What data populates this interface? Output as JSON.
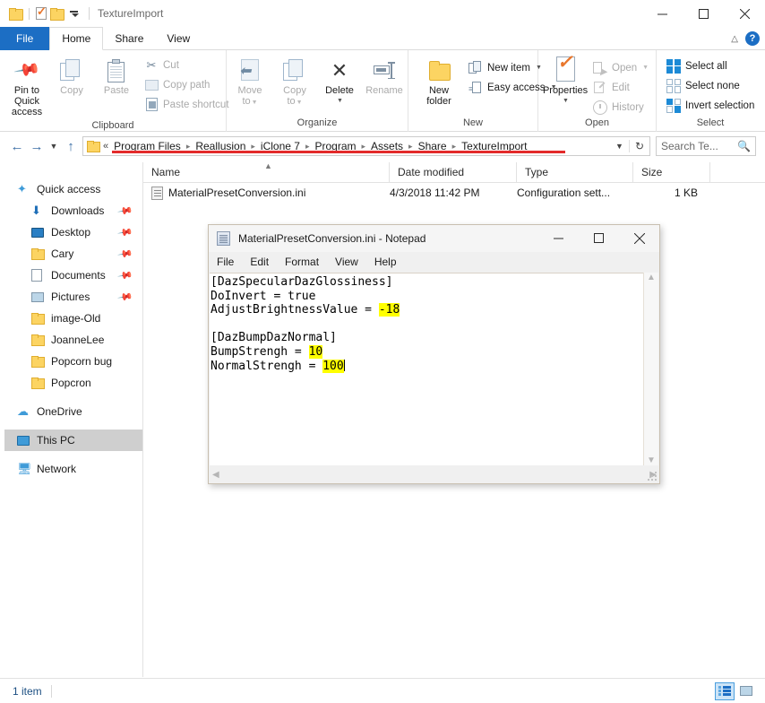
{
  "explorer": {
    "title": "TextureImport",
    "quick_access_toolbar": [
      {
        "name": "folder-properties-icon",
        "label": "Properties"
      },
      {
        "name": "new-folder-icon",
        "label": "New folder"
      },
      {
        "name": "customize-dropdown-icon",
        "label": "Customize Quick Access Toolbar"
      }
    ],
    "window_controls": {
      "minimize": "Minimize",
      "maximize": "Maximize",
      "close": "Close"
    },
    "tabs": [
      {
        "label": "File",
        "active": false
      },
      {
        "label": "Home",
        "active": true
      },
      {
        "label": "Share",
        "active": false
      },
      {
        "label": "View",
        "active": false
      }
    ],
    "ribbon_right": {
      "collapse": "Collapse the Ribbon",
      "help": "?"
    },
    "ribbon_groups": [
      {
        "label": "Clipboard",
        "big_buttons": [
          {
            "label": "Pin to Quick\naccess",
            "line1": "Pin to Quick",
            "line2": "access",
            "icon": "pin-icon",
            "disabled": false
          },
          {
            "label": "Copy",
            "line1": "Copy",
            "line2": "",
            "icon": "copy-icon",
            "disabled": true
          },
          {
            "label": "Paste",
            "line1": "Paste",
            "line2": "",
            "icon": "paste-icon",
            "disabled": true
          }
        ],
        "small_buttons": [
          {
            "label": "Cut",
            "icon": "scissors-icon",
            "disabled": true
          },
          {
            "label": "Copy path",
            "icon": "copy-path-icon",
            "disabled": true
          },
          {
            "label": "Paste shortcut",
            "icon": "paste-shortcut-icon",
            "disabled": true
          }
        ]
      },
      {
        "label": "Organize",
        "big_buttons": [
          {
            "label": "Move to",
            "line1": "Move",
            "line2": "to",
            "icon": "move-to-icon",
            "disabled": true,
            "caret": true
          },
          {
            "label": "Copy to",
            "line1": "Copy",
            "line2": "to",
            "icon": "copy-to-icon",
            "disabled": true,
            "caret": true
          },
          {
            "label": "Delete",
            "line1": "Delete",
            "line2": "",
            "icon": "delete-icon",
            "disabled": false,
            "caret": true
          },
          {
            "label": "Rename",
            "line1": "Rename",
            "line2": "",
            "icon": "rename-icon",
            "disabled": true
          }
        ],
        "small_buttons": []
      },
      {
        "label": "New",
        "big_buttons": [
          {
            "label": "New folder",
            "line1": "New",
            "line2": "folder",
            "icon": "new-folder-icon",
            "disabled": false
          }
        ],
        "small_buttons": [
          {
            "label": "New item",
            "icon": "new-item-icon",
            "disabled": false,
            "caret": true
          },
          {
            "label": "Easy access",
            "icon": "easy-access-icon",
            "disabled": false,
            "caret": true
          }
        ]
      },
      {
        "label": "Open",
        "big_buttons": [
          {
            "label": "Properties",
            "line1": "Properties",
            "line2": "",
            "icon": "properties-icon",
            "disabled": false,
            "caret": true
          }
        ],
        "small_buttons": [
          {
            "label": "Open",
            "icon": "open-icon",
            "disabled": true,
            "caret": true
          },
          {
            "label": "Edit",
            "icon": "edit-icon",
            "disabled": true
          },
          {
            "label": "History",
            "icon": "history-icon",
            "disabled": true
          }
        ]
      },
      {
        "label": "Select",
        "big_buttons": [],
        "small_buttons": [
          {
            "label": "Select all",
            "icon": "select-all-icon",
            "disabled": false
          },
          {
            "label": "Select none",
            "icon": "select-none-icon",
            "disabled": false
          },
          {
            "label": "Invert selection",
            "icon": "invert-selection-icon",
            "disabled": false
          }
        ]
      }
    ],
    "nav": {
      "back": "Back",
      "forward": "Forward",
      "recent": "Recent locations",
      "up": "Up"
    },
    "address": {
      "overflow": "«",
      "crumbs": [
        "Program Files",
        "Reallusion",
        "iClone 7",
        "Program",
        "Assets",
        "Share",
        "TextureImport"
      ],
      "annotation_color": "#e32b2b"
    },
    "search": {
      "placeholder": "Search Te...",
      "icon": "search-icon"
    },
    "columns": [
      {
        "label": "Name",
        "sorted": true
      },
      {
        "label": "Date modified",
        "sorted": false
      },
      {
        "label": "Type",
        "sorted": false
      },
      {
        "label": "Size",
        "sorted": false
      }
    ],
    "sidebar": [
      {
        "label": "Quick access",
        "icon": "star-icon",
        "indent": false,
        "pinned": false,
        "selected": false
      },
      {
        "label": "Downloads",
        "icon": "downloads-icon",
        "indent": true,
        "pinned": true,
        "selected": false
      },
      {
        "label": "Desktop",
        "icon": "desktop-icon",
        "indent": true,
        "pinned": true,
        "selected": false
      },
      {
        "label": "Cary",
        "icon": "folder-icon",
        "indent": true,
        "pinned": true,
        "selected": false
      },
      {
        "label": "Documents",
        "icon": "documents-icon",
        "indent": true,
        "pinned": true,
        "selected": false
      },
      {
        "label": "Pictures",
        "icon": "pictures-icon",
        "indent": true,
        "pinned": true,
        "selected": false
      },
      {
        "label": "image-Old",
        "icon": "folder-icon",
        "indent": true,
        "pinned": false,
        "selected": false
      },
      {
        "label": "JoanneLee",
        "icon": "folder-icon",
        "indent": true,
        "pinned": false,
        "selected": false
      },
      {
        "label": "Popcorn bug",
        "icon": "folder-icon",
        "indent": true,
        "pinned": false,
        "selected": false
      },
      {
        "label": "Popcron",
        "icon": "folder-icon",
        "indent": true,
        "pinned": false,
        "selected": false
      },
      {
        "label": "OneDrive",
        "icon": "cloud-icon",
        "indent": false,
        "pinned": false,
        "selected": false
      },
      {
        "label": "This PC",
        "icon": "pc-icon",
        "indent": false,
        "pinned": false,
        "selected": true
      },
      {
        "label": "Network",
        "icon": "network-icon",
        "indent": false,
        "pinned": false,
        "selected": false
      }
    ],
    "files": [
      {
        "name": "MaterialPresetConversion.ini",
        "date_modified": "4/3/2018 11:42 PM",
        "type": "Configuration sett...",
        "size": "1 KB",
        "icon": "ini-file-icon"
      }
    ],
    "status": {
      "text": "1 item",
      "views": [
        {
          "name": "details-view-button",
          "label": "Details view",
          "active": true
        },
        {
          "name": "thumbnail-view-button",
          "label": "Large icons view",
          "active": false
        }
      ]
    }
  },
  "notepad": {
    "title": "MaterialPresetConversion.ini - Notepad",
    "icon": "notepad-icon",
    "menu": [
      "File",
      "Edit",
      "Format",
      "View",
      "Help"
    ],
    "window_controls": {
      "minimize": "Minimize",
      "maximize": "Maximize",
      "close": "Close"
    },
    "highlight_color": "#ffff00",
    "content_lines": [
      {
        "segments": [
          {
            "t": "[DazSpecularDazGlossiness]",
            "hl": false
          }
        ]
      },
      {
        "segments": [
          {
            "t": "DoInvert = true",
            "hl": false
          }
        ]
      },
      {
        "segments": [
          {
            "t": "AdjustBrightnessValue = ",
            "hl": false
          },
          {
            "t": "-18",
            "hl": true
          }
        ]
      },
      {
        "segments": [
          {
            "t": "",
            "hl": false
          }
        ]
      },
      {
        "segments": [
          {
            "t": "[DazBumpDazNormal]",
            "hl": false
          }
        ]
      },
      {
        "segments": [
          {
            "t": "BumpStrengh = ",
            "hl": false
          },
          {
            "t": "10",
            "hl": true
          }
        ]
      },
      {
        "segments": [
          {
            "t": "NormalStrengh = ",
            "hl": false
          },
          {
            "t": "100",
            "hl": true
          }
        ],
        "caret": true
      }
    ]
  }
}
